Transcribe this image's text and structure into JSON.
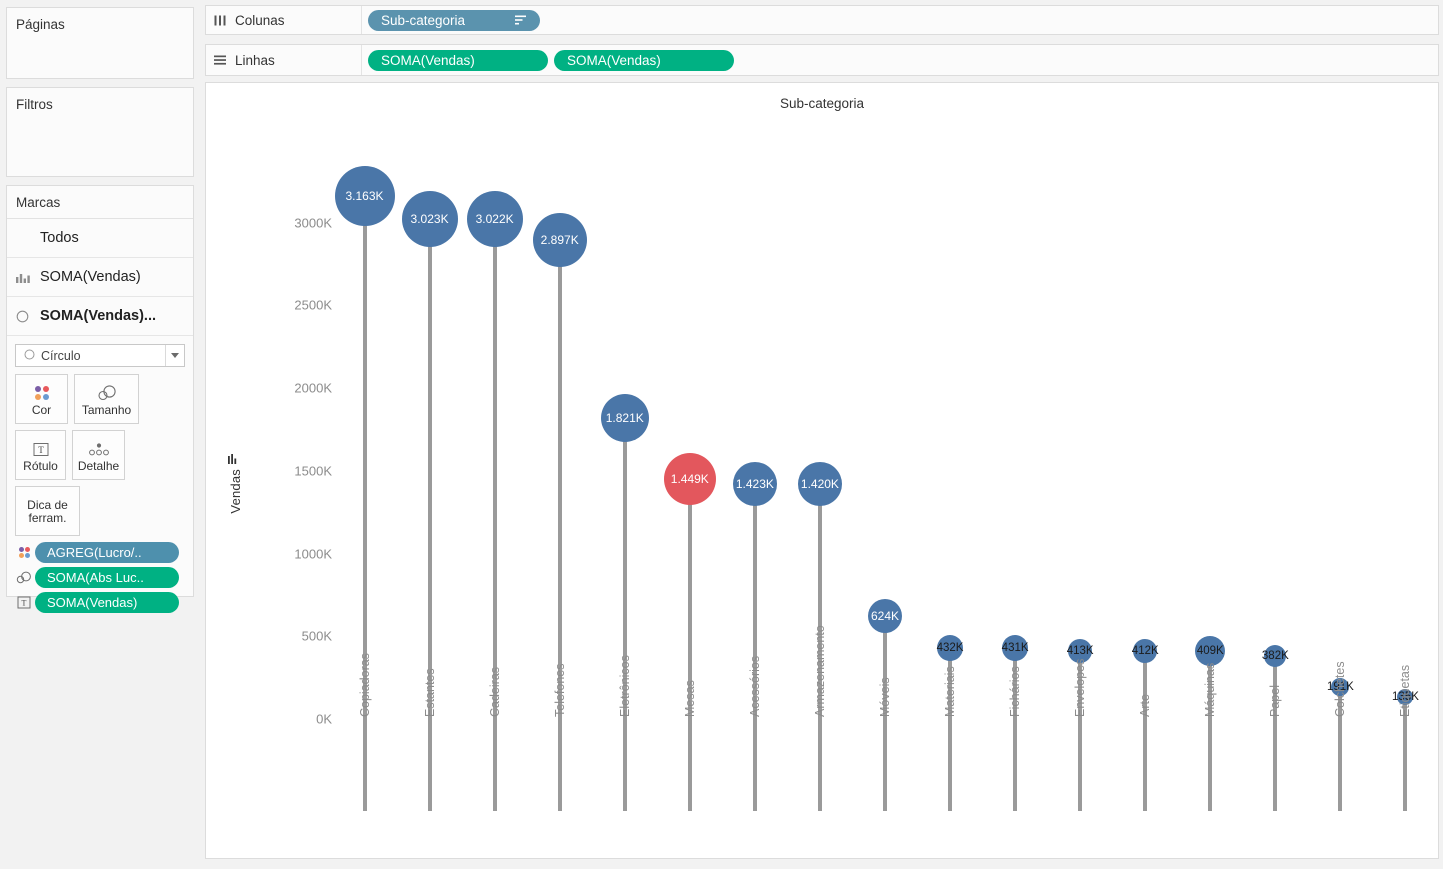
{
  "left_panel": {
    "pages_title": "Páginas",
    "filters_title": "Filtros",
    "marks_title": "Marcas",
    "marks_rows": [
      {
        "label": "Todos",
        "icon": ""
      },
      {
        "label": "SOMA(Vendas)",
        "icon": "bar-chart-icon"
      },
      {
        "label": "SOMA(Vendas)...",
        "icon": "circle-icon"
      }
    ],
    "mark_type": "Círculo",
    "buttons": [
      {
        "label": "Cor",
        "icon": "color-dots-icon"
      },
      {
        "label": "Tamanho",
        "icon": "size-circles-icon"
      },
      {
        "label": "Rótulo",
        "icon": "label-text-icon"
      },
      {
        "label": "Detalhe",
        "icon": "detail-dots-icon"
      },
      {
        "label": "Dica de ferram.",
        "icon": "tooltip-icon"
      }
    ],
    "pills": [
      {
        "label": "AGREG(Lucro/..",
        "color": "#4e90ad",
        "icon": "color-dots-icon"
      },
      {
        "label": "SOMA(Abs Luc..",
        "color": "#00b183",
        "icon": "size-circles-icon"
      },
      {
        "label": "SOMA(Vendas)",
        "color": "#00b183",
        "icon": "label-text-icon"
      }
    ]
  },
  "shelves": {
    "columns_label": "Colunas",
    "columns_icon": "columns-icon",
    "rows_label": "Linhas",
    "rows_icon": "rows-icon",
    "columns_pills": [
      {
        "label": "Sub-categoria",
        "color": "#5b93ae",
        "sort_icon": "sort-descending-icon"
      }
    ],
    "rows_pills": [
      {
        "label": "SOMA(Vendas)",
        "color": "#00b183"
      },
      {
        "label": "SOMA(Vendas)",
        "color": "#00b183"
      }
    ]
  },
  "view": {
    "title": "Sub-categoria",
    "y_axis_title": "Vendas",
    "y_axis_sort_icon": "sort-icon"
  },
  "colors": {
    "blue_mark": "#4a76a8",
    "red_mark": "#e3575d",
    "stem": "#9a9a9a",
    "green_pill": "#00b183",
    "blue_pill": "#4e90ad"
  },
  "chart_data": {
    "type": "scatter",
    "title": "Sub-categoria",
    "xlabel": "Sub-categoria",
    "ylabel": "Vendas",
    "ylim": [
      0,
      3300
    ],
    "y_ticks": [
      "0K",
      "500K",
      "1000K",
      "1500K",
      "2000K",
      "2500K",
      "3000K"
    ],
    "y_tick_values": [
      0,
      500,
      1000,
      1500,
      2000,
      2500,
      3000
    ],
    "grid": false,
    "legend": "none",
    "categories": [
      "Copiadoras",
      "Estantes",
      "Cadeiras",
      "Telefones",
      "Eletrônicos",
      "Mesas",
      "Acessórios",
      "Armazenamento",
      "Móveis",
      "Materiais",
      "Fichários",
      "Envelopes",
      "Arte",
      "Máquinas",
      "Papel",
      "Colchetes",
      "Etiquetas"
    ],
    "values": [
      3163,
      3023,
      3022,
      2897,
      1821,
      1449,
      1423,
      1420,
      624,
      432,
      431,
      413,
      412,
      409,
      382,
      191,
      135
    ],
    "labels": [
      "3.163K",
      "3.023K",
      "3.022K",
      "2.897K",
      "1.821K",
      "1.449K",
      "1.423K",
      "1.420K",
      "624K",
      "432K",
      "431K",
      "413K",
      "412K",
      "409K",
      "382K",
      "191K",
      "135K"
    ],
    "point_colors": [
      "#4a76a8",
      "#4a76a8",
      "#4a76a8",
      "#4a76a8",
      "#4a76a8",
      "#e3575d",
      "#4a76a8",
      "#4a76a8",
      "#4a76a8",
      "#4a76a8",
      "#4a76a8",
      "#4a76a8",
      "#4a76a8",
      "#4a76a8",
      "#4a76a8",
      "#4a76a8",
      "#4a76a8"
    ],
    "point_sizes": [
      60,
      56,
      56,
      54,
      48,
      52,
      44,
      44,
      34,
      26,
      26,
      24,
      24,
      30,
      22,
      18,
      16
    ]
  }
}
